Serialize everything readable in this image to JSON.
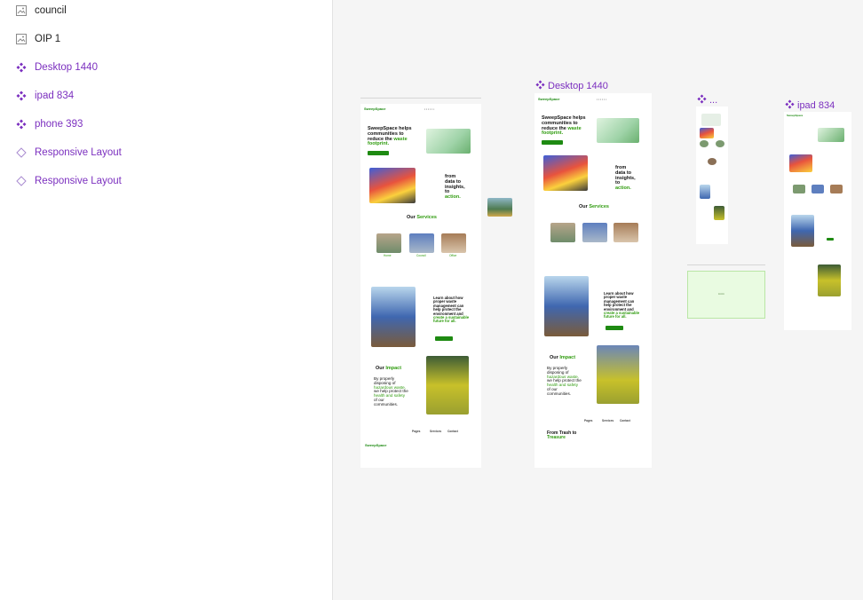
{
  "layers": [
    {
      "label": "council",
      "kind": "image",
      "icon": "image-icon"
    },
    {
      "label": "OIP 1",
      "kind": "image",
      "icon": "image-icon"
    },
    {
      "label": "Desktop 1440",
      "kind": "component",
      "icon": "component-icon"
    },
    {
      "label": "ipad 834",
      "kind": "component",
      "icon": "component-icon"
    },
    {
      "label": "phone 393",
      "kind": "component",
      "icon": "component-icon"
    },
    {
      "label": "Responsive Layout",
      "kind": "instance",
      "icon": "instance-icon"
    },
    {
      "label": "Responsive Layout",
      "kind": "instance",
      "icon": "instance-icon"
    }
  ],
  "canvas": {
    "frame_labels": {
      "desktop": "Desktop 1440",
      "phone": "...",
      "ipad": "ipad 834"
    },
    "site": {
      "logo": "SweepSpace",
      "hero_line1": "SweepSpace helps",
      "hero_line2": "communities to",
      "hero_line3_a": "reduce the ",
      "hero_line3_b": "waste",
      "hero_line4": "footprint.",
      "data_1": "from",
      "data_2": "data to",
      "data_3": "insights,",
      "data_4": "to",
      "data_5": "action.",
      "services_a": "Our ",
      "services_b": "Services",
      "service_1": "Home",
      "service_2": "Council",
      "service_3": "Office",
      "learn_1": "Learn about how",
      "learn_2": "proper waste",
      "learn_3": "management can",
      "learn_4": "help protect the",
      "learn_5": "environment and",
      "learn_6": "create a sustainable",
      "learn_7": "future for all.",
      "impact_a": "Our ",
      "impact_b": "Impact",
      "impact_1": "By properly",
      "impact_2": "disposing of",
      "impact_3": "hazardous waste,",
      "impact_4": "we help protect the",
      "impact_5": "health and safety",
      "impact_6": "of our",
      "impact_7": "communities.",
      "footer_col1": "Pages",
      "footer_col2": "Services",
      "footer_col3": "Contact",
      "footer_tag_a": "From Trash to",
      "footer_tag_b": "Treasure"
    }
  }
}
